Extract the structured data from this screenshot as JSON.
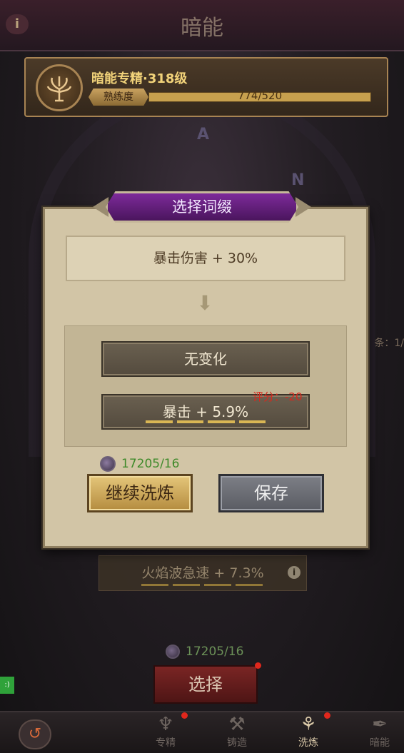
{
  "header": {
    "title": "暗能"
  },
  "mastery": {
    "title": "暗能专精·318级",
    "proficiency_label": "熟练度",
    "proficiency_value": "774/520"
  },
  "modal": {
    "title": "选择词缀",
    "current_affix": "暴击伤害 + 30%",
    "option_none": "无变化",
    "option_new": "暴击 + 5.9%",
    "score_label": "评分：-20",
    "cost": "17205/16",
    "continue_button": "继续洗炼",
    "save_button": "保存"
  },
  "background": {
    "affix": "火焰波急速 + 7.3%",
    "cost": "17205/16",
    "select_button": "选择",
    "side_text": "条：1/"
  },
  "nav": {
    "items": [
      {
        "label": "专精",
        "icon": "tree-icon"
      },
      {
        "label": "铸造",
        "icon": "anvil-icon"
      },
      {
        "label": "洗炼",
        "icon": "triskelion-icon"
      },
      {
        "label": "暗能",
        "icon": "feather-icon"
      }
    ]
  },
  "colors": {
    "accent_purple": "#6a1f85",
    "gold": "#d9b654",
    "score_red": "#d8271d",
    "cost_green": "#3f8a2a"
  }
}
